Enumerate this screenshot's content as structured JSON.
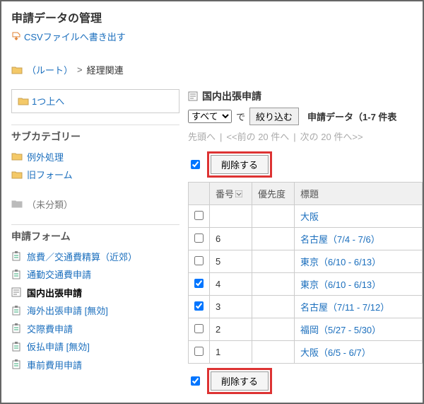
{
  "page_title": "申請データの管理",
  "export_label": "CSVファイルへ書き出す",
  "breadcrumb": {
    "root": "（ルート）",
    "sep": ">",
    "current": "経理関連"
  },
  "sidebar": {
    "up_label": "1つ上へ",
    "subcategory_heading": "サブカテゴリー",
    "subcategories": [
      {
        "label": "例外処理"
      },
      {
        "label": "旧フォーム"
      }
    ],
    "uncategorized_label": "（未分類）",
    "forms_heading": "申請フォーム",
    "forms": [
      {
        "label": "旅費／交通費精算（近郊）"
      },
      {
        "label": "通勤交通費申請"
      },
      {
        "label": "国内出張申請",
        "selected": true
      },
      {
        "label": "海外出張申請 [無効]"
      },
      {
        "label": "交際費申請"
      },
      {
        "label": "仮払申請 [無効]"
      },
      {
        "label": "車前費用申請"
      }
    ]
  },
  "main": {
    "title": "国内出張申請",
    "filter_select": "すべて",
    "filter_de": "で",
    "filter_button": "絞り込む",
    "result_label": "申請データ（1-7 件表",
    "pager": {
      "first": "先頭へ",
      "prev": "<<前の 20 件へ",
      "next": "次の 20 件へ>>"
    },
    "delete_label": "削除する",
    "columns": {
      "number": "番号",
      "priority": "優先度",
      "subject": "標題"
    },
    "rows": [
      {
        "number": "",
        "priority": "",
        "subject": "大阪",
        "checked": false
      },
      {
        "number": "6",
        "priority": "",
        "subject": "名古屋（7/4 - 7/6）",
        "checked": false
      },
      {
        "number": "5",
        "priority": "",
        "subject": "東京（6/10 - 6/13）",
        "checked": false
      },
      {
        "number": "4",
        "priority": "",
        "subject": "東京（6/10 - 6/13）",
        "checked": true
      },
      {
        "number": "3",
        "priority": "",
        "subject": "名古屋（7/11 - 7/12）",
        "checked": true
      },
      {
        "number": "2",
        "priority": "",
        "subject": "福岡（5/27 - 5/30）",
        "checked": false
      },
      {
        "number": "1",
        "priority": "",
        "subject": "大阪（6/5 - 6/7）",
        "checked": false
      }
    ]
  }
}
